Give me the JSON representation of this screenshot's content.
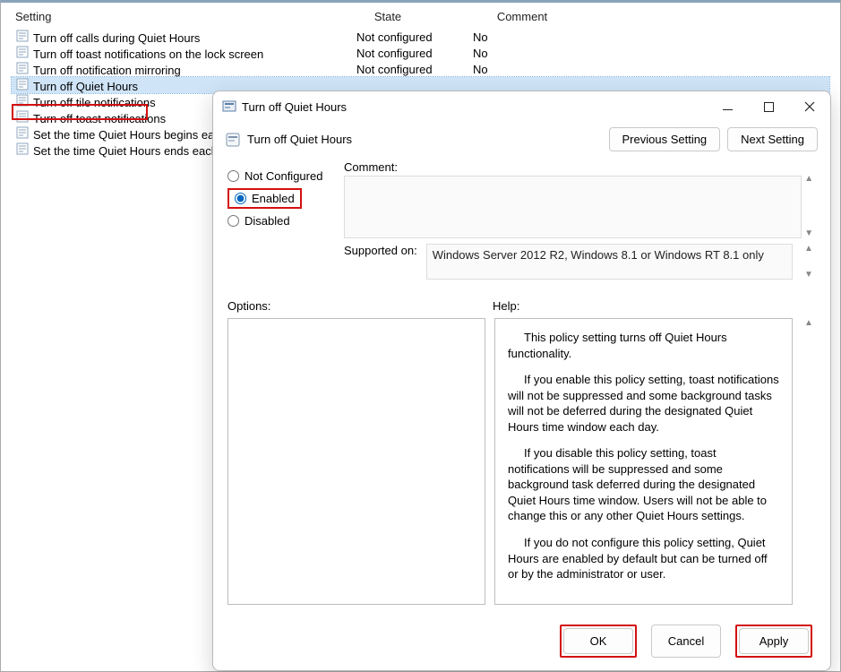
{
  "gridHeaders": {
    "setting": "Setting",
    "state": "State",
    "comment": "Comment"
  },
  "rows": [
    {
      "name": "Turn off calls during Quiet Hours",
      "state": "Not configured",
      "comment": "No"
    },
    {
      "name": "Turn off toast notifications on the lock screen",
      "state": "Not configured",
      "comment": "No"
    },
    {
      "name": "Turn off notification mirroring",
      "state": "Not configured",
      "comment": "No"
    },
    {
      "name": "Turn off Quiet Hours",
      "state": "",
      "comment": ""
    },
    {
      "name": "Turn off tile notifications",
      "state": "",
      "comment": ""
    },
    {
      "name": "Turn off toast notifications",
      "state": "",
      "comment": ""
    },
    {
      "name": "Set the time Quiet Hours begins each day",
      "state": "",
      "comment": ""
    },
    {
      "name": "Set the time Quiet Hours ends each day",
      "state": "",
      "comment": ""
    }
  ],
  "dialog": {
    "title": "Turn off Quiet Hours",
    "policyTitle": "Turn off Quiet Hours",
    "prevBtn": "Previous Setting",
    "nextBtn": "Next Setting",
    "radios": {
      "notConfigured": "Not Configured",
      "enabled": "Enabled",
      "disabled": "Disabled"
    },
    "commentLabel": "Comment:",
    "supportedLabel": "Supported on:",
    "supportedText": "Windows Server 2012 R2, Windows 8.1 or Windows RT 8.1 only",
    "optionsLabel": "Options:",
    "helpLabel": "Help:",
    "help": {
      "p1": "This policy setting turns off Quiet Hours functionality.",
      "p2": "If you enable this policy setting, toast notifications will not be suppressed and some background tasks will not be deferred during the designated Quiet Hours time window each day.",
      "p3": "If you disable this policy setting, toast notifications will be suppressed and some background task deferred during the designated Quiet Hours time window.  Users will not be able to change this or any other Quiet Hours settings.",
      "p4": "If you do not configure this policy setting, Quiet Hours are enabled by default but can be turned off or by the administrator or user."
    },
    "buttons": {
      "ok": "OK",
      "cancel": "Cancel",
      "apply": "Apply"
    }
  }
}
